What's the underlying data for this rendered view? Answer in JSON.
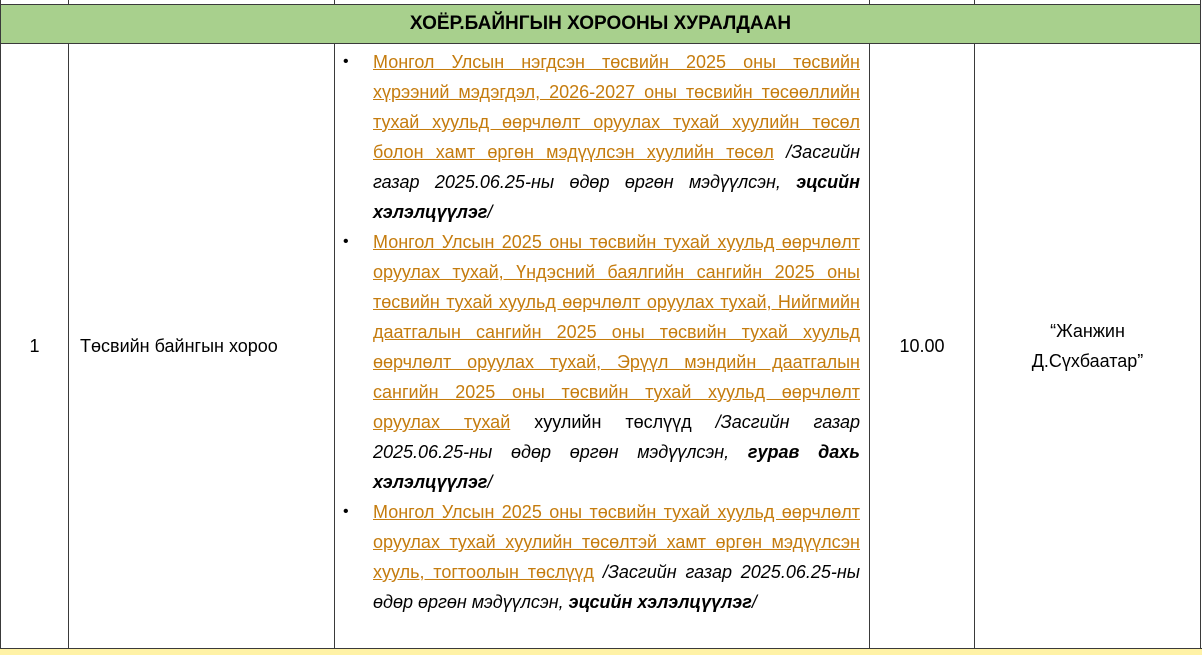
{
  "section": {
    "title": "ХОЁР.БАЙНГЫН ХОРООНЫ ХУРАЛДААН"
  },
  "row": {
    "number": "1",
    "committee": "Төсвийн байнгын хороо",
    "time": "10.00",
    "place_line1": "“Жанжин",
    "place_line2": "Д.Сүхбаатар”",
    "items": [
      {
        "bullet": "•",
        "link": " Монгол Улсын нэгдсэн төсвийн 2025 оны төсвийн хүрээний мэдэгдэл, 2026-2027 оны төсвийн төсөөллийн тухай хуульд өөрчлөлт оруулах тухай хуулийн төсөл болон хамт өргөн мэдүүлсэн хуулийн төсөл",
        "plain": "",
        "note": " /Засгийн газар 2025.06.25-ны өдөр өргөн мэдүүлсэн, ",
        "note_bold": "эцсийн хэлэлцүүлэг",
        "note_end": "/"
      },
      {
        "bullet": "•",
        "link": "  Монгол Улсын 2025 оны төсвийн тухай хуульд өөрчлөлт оруулах тухай, Үндэсний баялгийн сангийн 2025 оны төсвийн тухай хуульд өөрчлөлт оруулах тухай, Нийгмийн даатгалын сангийн 2025 оны төсвийн тухай хуульд өөрчлөлт оруулах тухай, Эрүүл мэндийн даатгалын сангийн 2025 оны төсвийн тухай хуульд өөрчлөлт оруулах тухай",
        "plain": " хуулийн төслүүд ",
        "note": " /Засгийн газар 2025.06.25-ны өдөр өргөн мэдүүлсэн, ",
        "note_bold": "гурав дахь хэлэлцүүлэг",
        "note_end": "/"
      },
      {
        "bullet": "•",
        "link": "  Монгол Улсын 2025 оны төсвийн тухай хуульд өөрчлөлт оруулах тухай хуулийн төсөлтэй хамт өргөн мэдүүлсэн хууль, тогтоолын төслүүд",
        "plain": "",
        "note": " /Засгийн газар 2025.06.25-ны өдөр өргөн мэдүүлсэн, ",
        "note_bold": "эцсийн хэлэлцүүлэг",
        "note_end": "/"
      }
    ]
  },
  "colors": {
    "header_bg": "#a8d08d",
    "link": "#c57c0e",
    "border": "#3a3a3a",
    "footer_bg": "#fff2a6"
  }
}
